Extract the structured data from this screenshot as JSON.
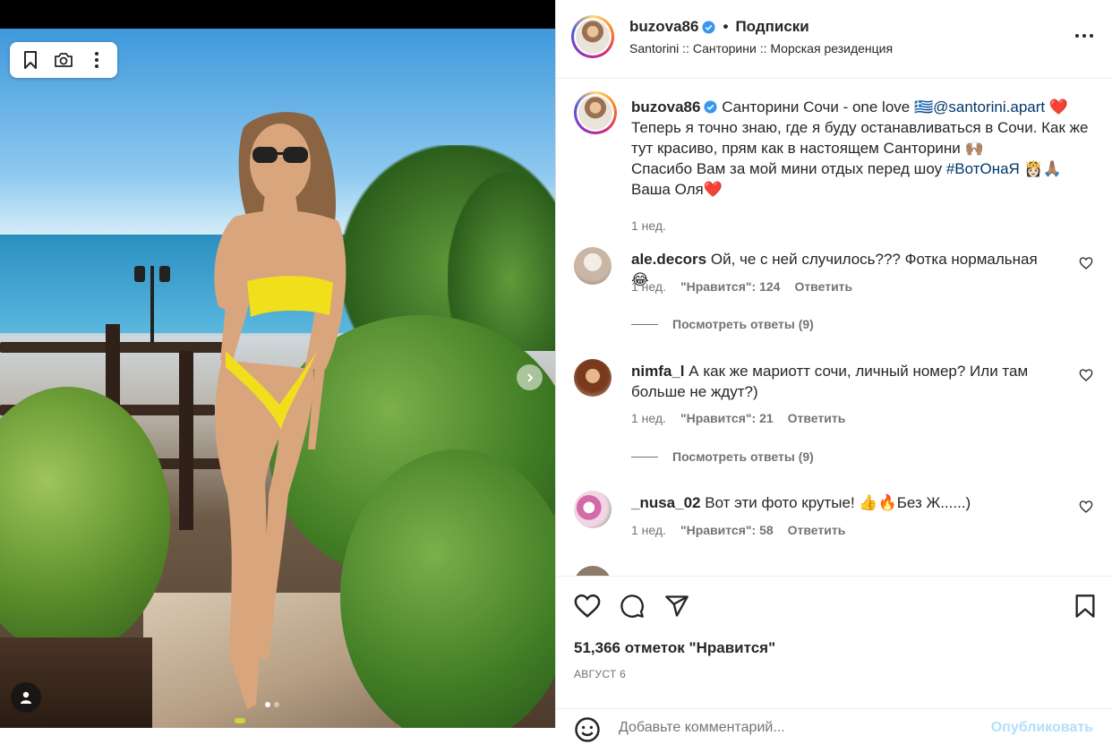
{
  "post": {
    "username": "buzova86",
    "follow_label": "Подписки",
    "location": "Santorini :: Санторини :: Морская резиденция",
    "caption": {
      "line1_text": "Санторини Сочи - one love 🇬🇷",
      "mention": "@santorini.apart",
      "heart": "❤️",
      "line2": "Теперь я точно знаю, где я буду останавливаться в Сочи. Как же тут красиво, прям как в настоящем Санторини 🙌🏽",
      "line3_text": "Спасибо Вам за мой мини отдых перед шоу",
      "hashtag": "#ВотОнаЯ",
      "line3_emoji": "👸🏻🙏🏽",
      "line4": "Ваша Оля❤️",
      "time": "1 нед."
    },
    "comments": [
      {
        "username": "ale.decors",
        "text": "Ой, че с ней случилось??? Фотка нормальная 😂",
        "time": "1 нед.",
        "likes": "\"Нравится\": 124",
        "reply": "Ответить",
        "view_replies": "Посмотреть ответы (9)"
      },
      {
        "username": "nimfa_l",
        "text": "А как же мариотт сочи, личный номер? Или там больше не ждут?)",
        "time": "1 нед.",
        "likes": "\"Нравится\": 21",
        "reply": "Ответить",
        "view_replies": "Посмотреть ответы (9)"
      },
      {
        "username": "_nusa_02",
        "text": "Вот эти фото крутые! 👍🔥Без Ж......)",
        "time": "1 нед.",
        "likes": "\"Нравится\": 58",
        "reply": "Ответить"
      }
    ],
    "likes_count": "51,366 отметок \"Нравится\"",
    "date": "АВГУСТ 6",
    "comment_placeholder": "Добавьте комментарий...",
    "publish_label": "Опубликовать"
  },
  "colors": {
    "link": "#00376b",
    "verified": "#3897f0",
    "muted": "#737373",
    "publish_disabled": "#b2dffc"
  },
  "icons": {
    "toolbar": [
      "bookmark-icon",
      "camera-icon",
      "more-vertical-icon"
    ],
    "actions": [
      "heart-icon",
      "comment-icon",
      "share-icon",
      "save-icon"
    ]
  }
}
